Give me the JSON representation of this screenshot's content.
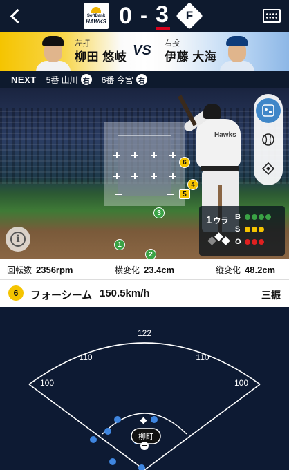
{
  "header": {
    "away_logo_line1": "SoftBank",
    "away_logo_line2": "HAWKS",
    "score_away": "0",
    "score_home": "3",
    "home_logo_letter": "F"
  },
  "matchup": {
    "batter_role": "左打",
    "batter_name": "柳田 悠岐",
    "vs_label": "VS",
    "pitcher_role": "右投",
    "pitcher_name": "伊藤 大海"
  },
  "next": {
    "label": "NEXT",
    "items": [
      {
        "text": "5番 山川",
        "hand": "右"
      },
      {
        "text": "6番 今宮",
        "hand": "右"
      }
    ]
  },
  "field": {
    "batter_number": "Hawks",
    "pitches": [
      {
        "num": "1",
        "kind": "strike"
      },
      {
        "num": "2",
        "kind": "strike"
      },
      {
        "num": "3",
        "kind": "strike"
      },
      {
        "num": "4",
        "kind": "ball"
      },
      {
        "num": "5",
        "kind": "ball"
      },
      {
        "num": "6",
        "kind": "ball"
      }
    ],
    "count": {
      "outs_num": "1",
      "outs_unit": "ウラ",
      "labels": [
        "B",
        "S",
        "O"
      ],
      "ball_colors": [
        "#3aa245",
        "#3aa245",
        "#3aa245",
        "#3aa245"
      ],
      "strike_colors": [
        "#f5c400",
        "#f5c400",
        "#f5c400"
      ],
      "out_colors": [
        "#e02020",
        "#e02020",
        "#e02020"
      ]
    },
    "tools": [
      "pitch-location-icon",
      "ball-icon",
      "diamond-icon"
    ],
    "info_glyph": "i"
  },
  "stats": {
    "spin_label": "回転数",
    "spin_value": "2356rpm",
    "hbreak_label": "横変化",
    "hbreak_value": "23.4cm",
    "vbreak_label": "縦変化",
    "vbreak_value": "48.2cm"
  },
  "pitch": {
    "number": "6",
    "type": "フォーシーム",
    "speed": "150.5km/h",
    "result": "三振"
  },
  "diamond": {
    "distance_center": "122",
    "distance_left_center": "110",
    "distance_right_center": "110",
    "distance_left": "100",
    "distance_right": "100",
    "batter_label": "柳町"
  }
}
